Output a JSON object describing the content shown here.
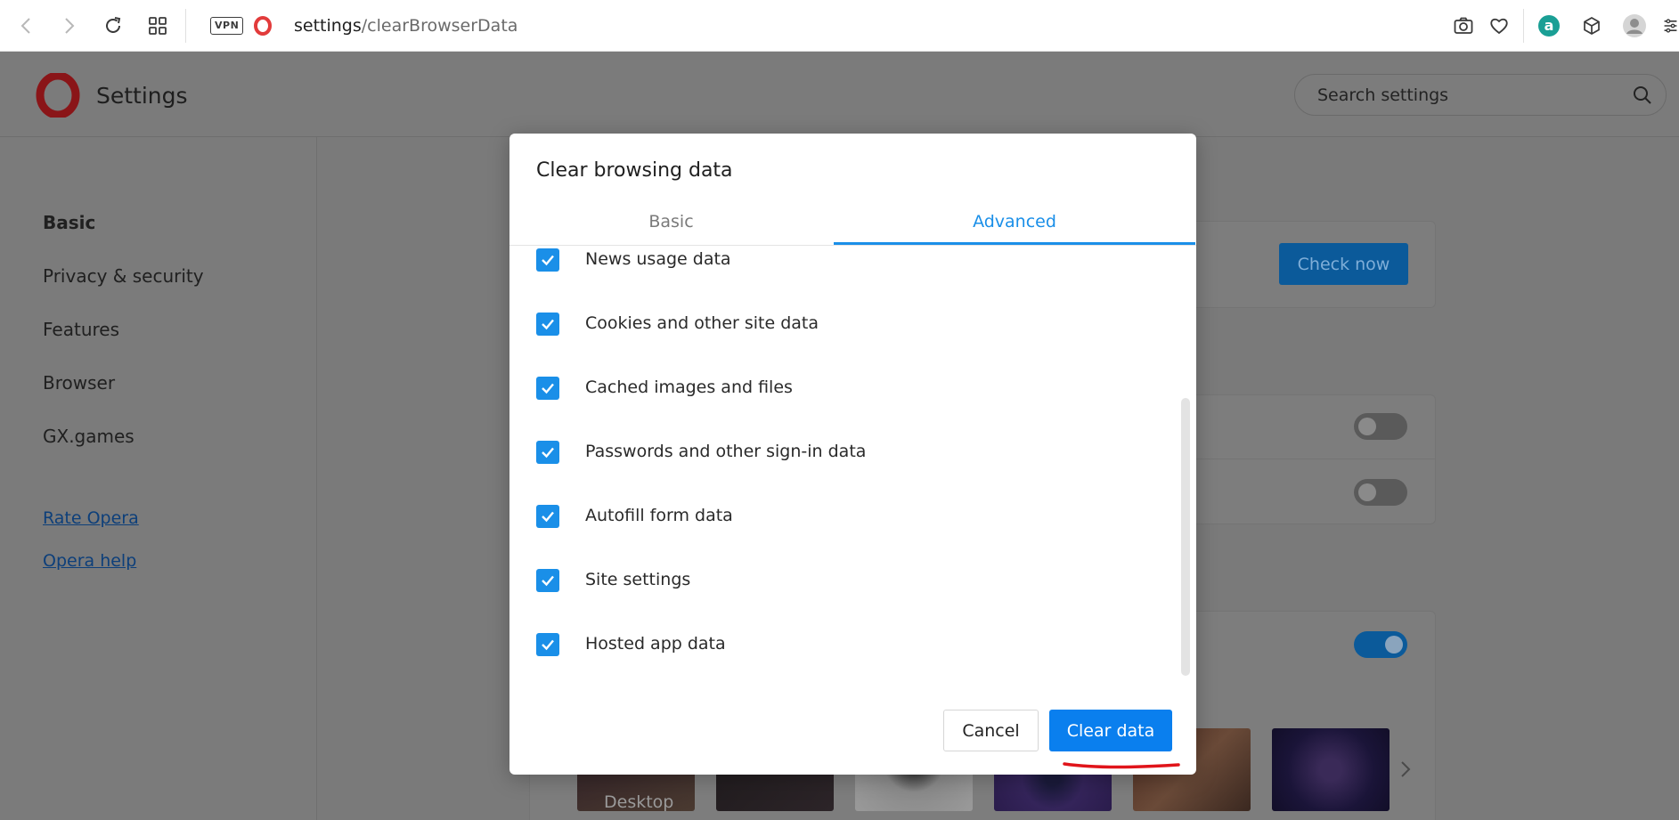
{
  "browser": {
    "url_host": "settings",
    "url_path": "/clearBrowserData",
    "vpn_label": "VPN"
  },
  "settings": {
    "title": "Settings",
    "search_placeholder": "Search settings"
  },
  "sidebar": {
    "items": [
      {
        "label": "Basic",
        "active": true
      },
      {
        "label": "Privacy & security",
        "active": false
      },
      {
        "label": "Features",
        "active": false
      },
      {
        "label": "Browser",
        "active": false
      },
      {
        "label": "GX.games",
        "active": false
      }
    ],
    "links": [
      {
        "label": "Rate Opera"
      },
      {
        "label": "Opera help"
      }
    ]
  },
  "main": {
    "check_now_label": "Check now",
    "wallpaper_label": "Desktop"
  },
  "dialog": {
    "title": "Clear browsing data",
    "tabs": [
      {
        "label": "Basic",
        "selected": false
      },
      {
        "label": "Advanced",
        "selected": true
      }
    ],
    "options": [
      {
        "label": "News usage data",
        "checked": true
      },
      {
        "label": "Cookies and other site data",
        "checked": true
      },
      {
        "label": "Cached images and files",
        "checked": true
      },
      {
        "label": "Passwords and other sign-in data",
        "checked": true
      },
      {
        "label": "Autofill form data",
        "checked": true
      },
      {
        "label": "Site settings",
        "checked": true
      },
      {
        "label": "Hosted app data",
        "checked": true
      }
    ],
    "cancel_label": "Cancel",
    "clear_label": "Clear data"
  },
  "colors": {
    "accent": "#1a8fe8",
    "primary_button": "#0a7fee",
    "opera_red": "#d8242c",
    "annotation_red": "#e0141a"
  }
}
